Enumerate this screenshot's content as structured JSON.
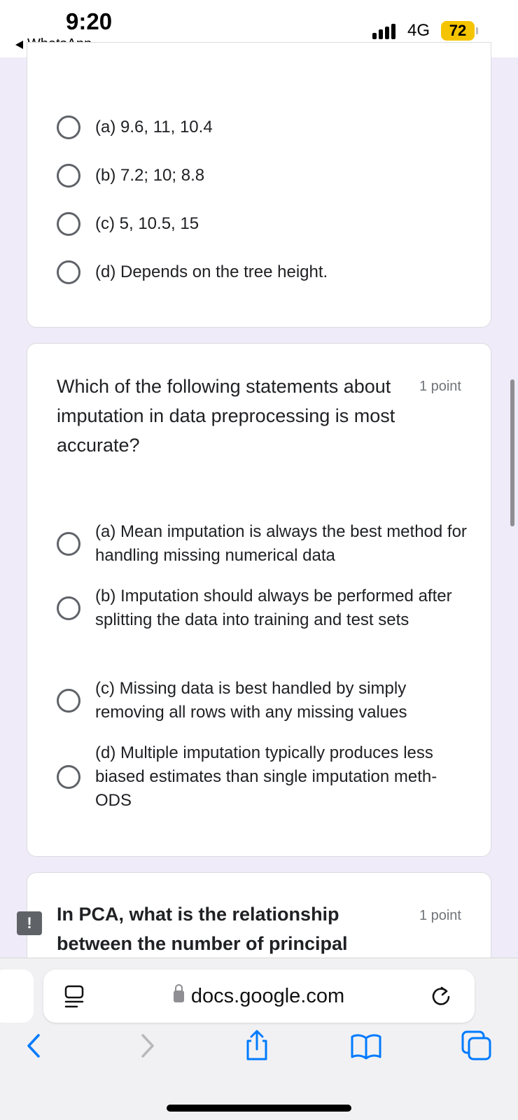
{
  "status_bar": {
    "time": "9:20",
    "back_app": "WhatsApp",
    "network": "4G",
    "battery": "72"
  },
  "question_previous": {
    "options": [
      {
        "label": "(a) 9.6, 11, 10.4",
        "selected": false
      },
      {
        "label": "(b) 7.2; 10; 8.8",
        "selected": false
      },
      {
        "label": "(c) 5, 10.5, 15",
        "selected": false
      },
      {
        "label": "(d) Depends on the tree height.",
        "selected": false
      }
    ]
  },
  "question_imputation": {
    "title": "Which of the following statements about imputation in data preprocessing is most accurate?",
    "points": "1 point",
    "options": [
      {
        "label": "(a) Mean imputation is always the best method for handling missing numerical data",
        "selected": false
      },
      {
        "label": "(b) Imputation should always be performed after splitting the data into training and test sets",
        "selected": false
      },
      {
        "label": "(c) Missing data is best handled by simply removing all rows with any missing values",
        "selected": false
      },
      {
        "label": "(d) Multiple imputation typically produces less biased estimates than single imputation meth-ODS",
        "selected": false
      }
    ]
  },
  "question_pca": {
    "title": "In PCA, what is the relationship between the number of principal components",
    "points": "1 point"
  },
  "feedback": {
    "label": "!"
  },
  "browser": {
    "url": "docs.google.com"
  },
  "icons": {
    "reader": "reader-mode-icon",
    "lock": "lock-icon",
    "reload": "reload-icon",
    "back": "back-chevron-icon",
    "forward": "forward-chevron-icon",
    "share": "share-icon",
    "bookmarks": "book-icon",
    "tabs": "tabs-icon"
  },
  "colors": {
    "background": "#f0ebf8",
    "battery": "#f5c400",
    "link_blue": "#007aff"
  }
}
